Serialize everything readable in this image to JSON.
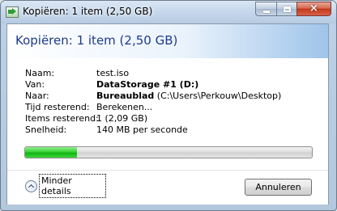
{
  "window": {
    "title": "Kopiëren: 1 item (2,50 GB)",
    "caption_buttons": {
      "minimize": "minimize-icon",
      "maximize": "maximize-icon",
      "close": "×"
    }
  },
  "main": {
    "heading": "Kopiëren: 1 item (2,50 GB)",
    "details": [
      {
        "label": "Naam:",
        "value": "test.iso"
      },
      {
        "label": "Van:",
        "value": "DataStorage #1 (D:)"
      },
      {
        "label": "Naar:",
        "value_bold": "Bureaublad",
        "value_rest": " (C:\\Users\\Perkouw\\Desktop)"
      },
      {
        "label": "Tijd resterend:",
        "value": "Berekenen..."
      },
      {
        "label": "Items resterend:",
        "value": "1 (2,09 GB)"
      },
      {
        "label": "Snelheid:",
        "value": "140 MB per seconde"
      }
    ],
    "progress": {
      "percent": 18
    }
  },
  "footer": {
    "details_toggle_label": "Minder details",
    "cancel_label": "Annuleren"
  },
  "colors": {
    "heading": "#1e3a8a",
    "progress": "#22c322"
  }
}
